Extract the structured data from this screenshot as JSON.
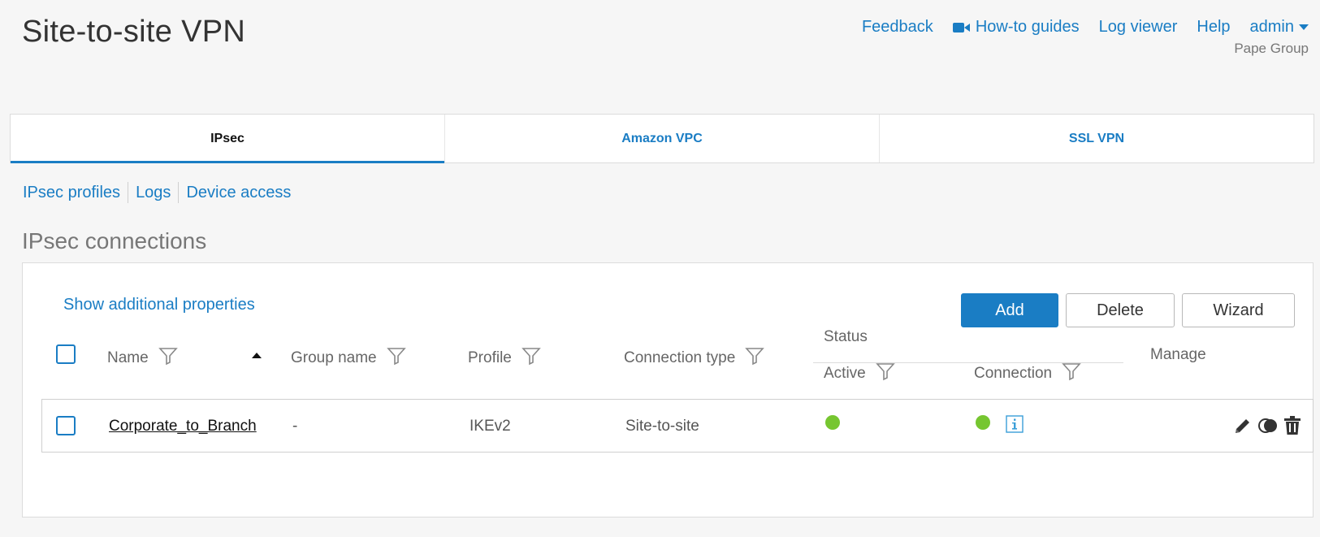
{
  "page": {
    "title": "Site-to-site VPN"
  },
  "top_nav": {
    "feedback": "Feedback",
    "howto": "How-to guides",
    "log_viewer": "Log viewer",
    "help": "Help",
    "admin": "admin",
    "org": "Pape Group"
  },
  "tabs": [
    {
      "label": "IPsec",
      "active": true
    },
    {
      "label": "Amazon VPC",
      "active": false
    },
    {
      "label": "SSL VPN",
      "active": false
    }
  ],
  "sublinks": [
    "IPsec profiles",
    "Logs",
    "Device access"
  ],
  "section": {
    "title": "IPsec connections"
  },
  "panel": {
    "show_props": "Show additional properties",
    "add": "Add",
    "delete": "Delete",
    "wizard": "Wizard"
  },
  "table": {
    "headers": {
      "name": "Name",
      "group": "Group name",
      "profile": "Profile",
      "conn_type": "Connection type",
      "status": "Status",
      "active": "Active",
      "connection": "Connection",
      "manage": "Manage"
    },
    "rows": [
      {
        "name": "Corporate_to_Branch",
        "group": "-",
        "profile": "IKEv2",
        "conn_type": "Site-to-site",
        "active": "green",
        "connection": "green"
      }
    ]
  },
  "colors": {
    "accent": "#1a7dc4",
    "status_on": "#76c630"
  },
  "icons": [
    "video-camera-icon",
    "chevron-down-icon",
    "filter-icon",
    "sort-asc-icon",
    "info-icon",
    "edit-icon",
    "toggle-icon",
    "trash-icon"
  ]
}
